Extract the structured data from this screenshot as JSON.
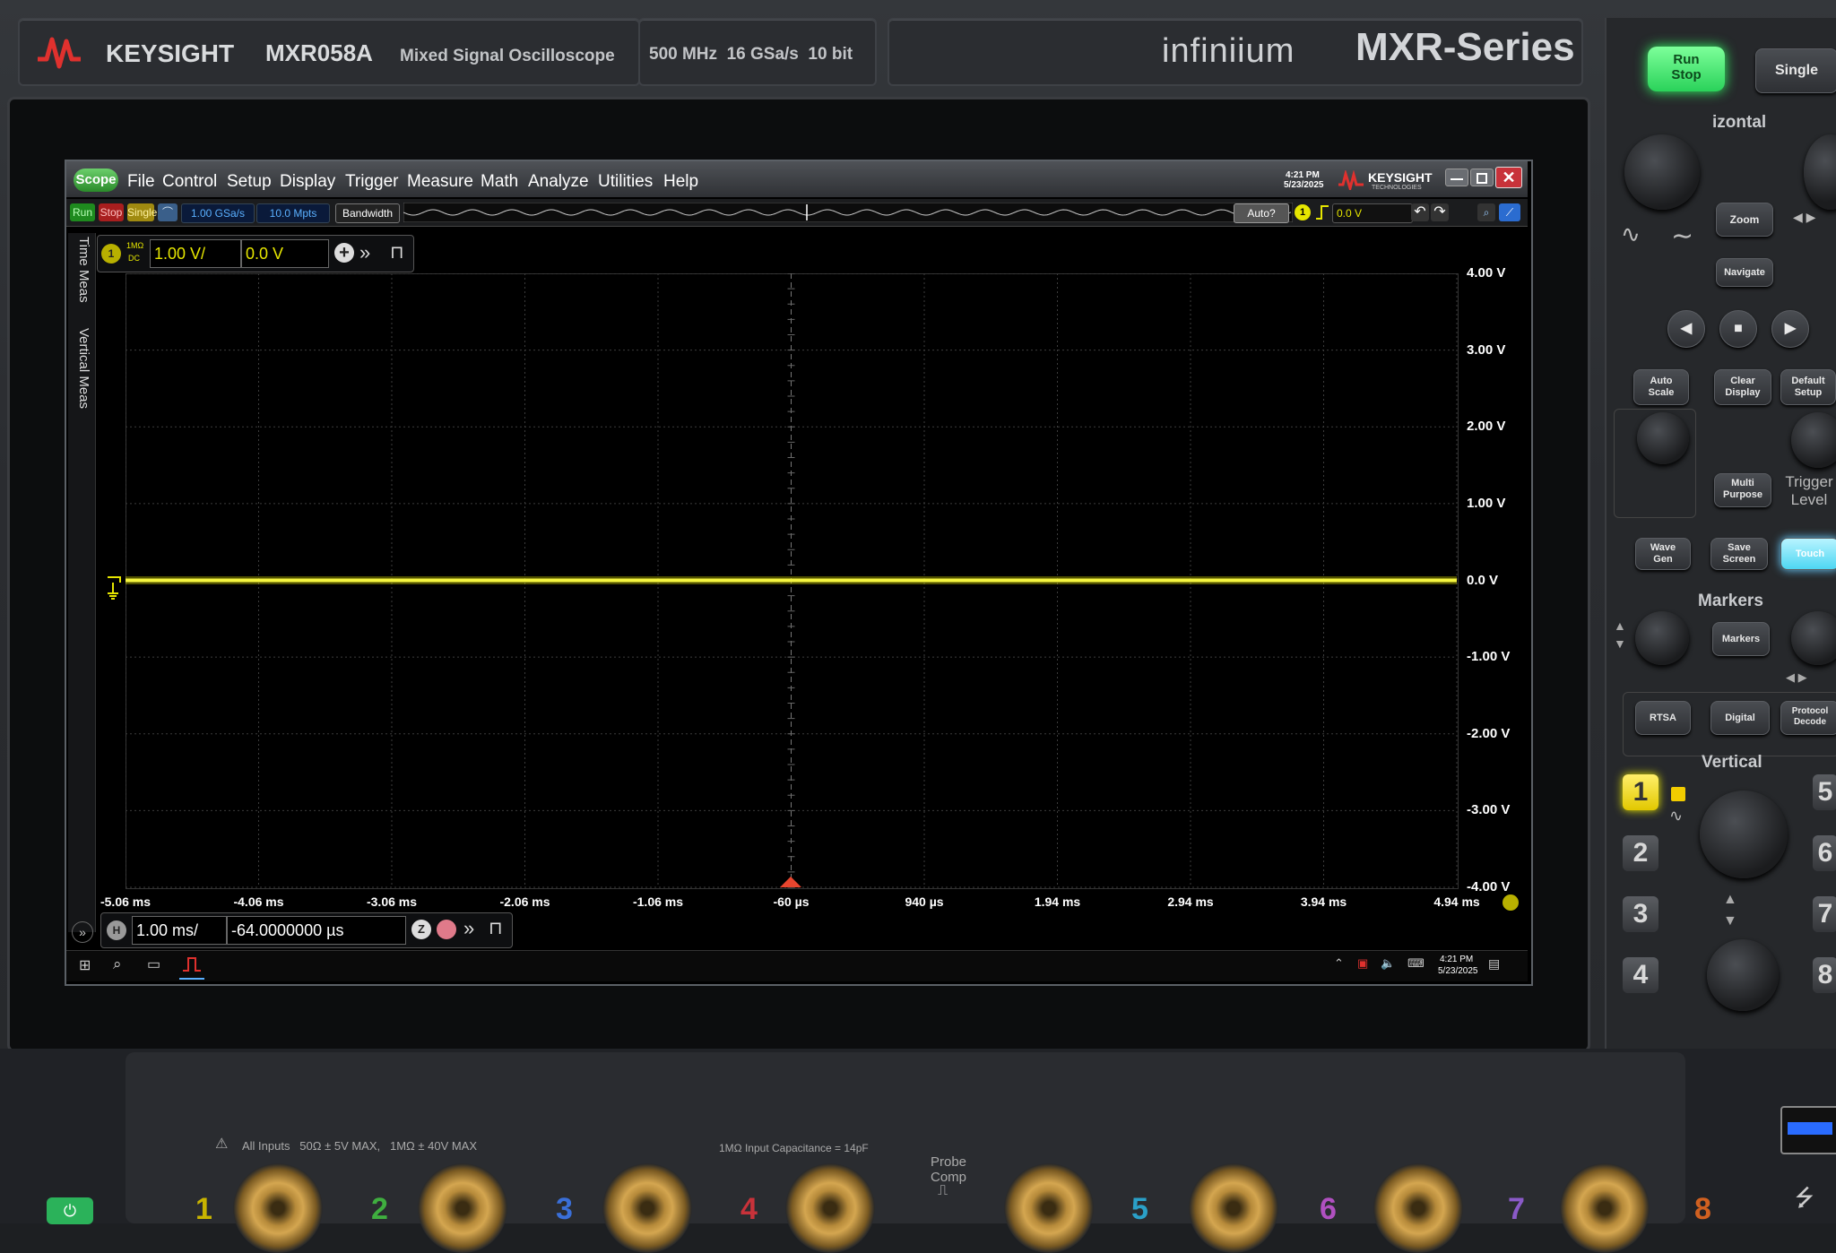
{
  "bezel": {
    "brand": "KEYSIGHT",
    "model": "MXR058A",
    "model_desc": "Mixed Signal Oscilloscope",
    "specs": "500 MHz  16 GSa/s  10 bit",
    "series_logo": "infiniium",
    "series": "MXR-Series"
  },
  "app": {
    "scope_badge": "Scope",
    "menu": [
      "File",
      "Control",
      "Setup",
      "Display",
      "Trigger",
      "Measure",
      "Math",
      "Analyze",
      "Utilities",
      "Help"
    ],
    "clock_time": "4:21 PM",
    "clock_date": "5/23/2025",
    "brand": "KEYSIGHT",
    "brand_sub": "TECHNOLOGIES"
  },
  "toolbar": {
    "run": "Run",
    "stop": "Stop",
    "single": "Single",
    "sample_rate": "1.00 GSa/s",
    "memory_depth": "10.0 Mpts",
    "bandwidth": "Bandwidth",
    "trigger_mode": "Auto?",
    "trigger_channel": "1",
    "trigger_level": "0.0 V"
  },
  "channel1": {
    "badge": "1",
    "coupling_top": "1MΩ",
    "coupling_bottom": "DC",
    "scale": "1.00 V/",
    "offset": "0.0 V",
    "color": "#e6e600"
  },
  "side_tabs": [
    "Time Meas",
    "Vertical Meas"
  ],
  "y_labels": [
    "4.00 V",
    "3.00 V",
    "2.00 V",
    "1.00 V",
    "0.0 V",
    "-1.00 V",
    "-2.00 V",
    "-3.00 V",
    "-4.00 V"
  ],
  "x_labels": [
    "-5.06 ms",
    "-4.06 ms",
    "-3.06 ms",
    "-2.06 ms",
    "-1.06 ms",
    "-60 µs",
    "940 µs",
    "1.94 ms",
    "2.94 ms",
    "3.94 ms",
    "4.94 ms"
  ],
  "horizontal": {
    "badge": "H",
    "scale": "1.00 ms/",
    "position": "-64.0000000 µs"
  },
  "trace": {
    "channel": "1",
    "level_volts": 0.0,
    "color": "#e6e600"
  },
  "taskbar": {
    "time": "4:21 PM",
    "date": "5/23/2025"
  },
  "front_panel": {
    "run_stop": "Run\nStop",
    "run_stop_l1": "Run",
    "run_stop_l2": "Stop",
    "single": "Single",
    "horizontal_label": "izontal",
    "zoom": "Zoom",
    "navigate": "Navigate",
    "auto_scale_l1": "Auto",
    "auto_scale_l2": "Scale",
    "clear_display_l1": "Clear",
    "clear_display_l2": "Display",
    "default_setup_l1": "Default",
    "default_setup_l2": "Setup",
    "multi_purpose_l1": "Multi",
    "multi_purpose_l2": "Purpose",
    "trigger_level_l1": "Trigger",
    "trigger_level_l2": "Level",
    "wave_gen_l1": "Wave",
    "wave_gen_l2": "Gen",
    "save_screen_l1": "Save",
    "save_screen_l2": "Screen",
    "touch": "Touch",
    "markers_label": "Markers",
    "markers_btn": "Markers",
    "rtsa": "RTSA",
    "digital": "Digital",
    "protocol_l1": "Protocol",
    "protocol_l2": "Decode",
    "vertical_label": "Vertical",
    "channels": [
      "1",
      "2",
      "3",
      "4",
      "5",
      "6",
      "7",
      "8"
    ]
  },
  "inputs": {
    "warning": "All Inputs   50Ω ± 5V MAX,   1MΩ ± 40V MAX",
    "capacitance": "1MΩ Input Capacitance = 14pF",
    "probe_comp_l1": "Probe",
    "probe_comp_l2": "Comp",
    "channel_numbers": [
      "1",
      "2",
      "3",
      "4",
      "5",
      "6",
      "7",
      "8"
    ],
    "channel_colors": [
      "#c9b400",
      "#3fae3f",
      "#3a6fd8",
      "#c8323a",
      "#2aa0c8",
      "#b050c0",
      "#8a5ac8",
      "#d06020"
    ]
  }
}
